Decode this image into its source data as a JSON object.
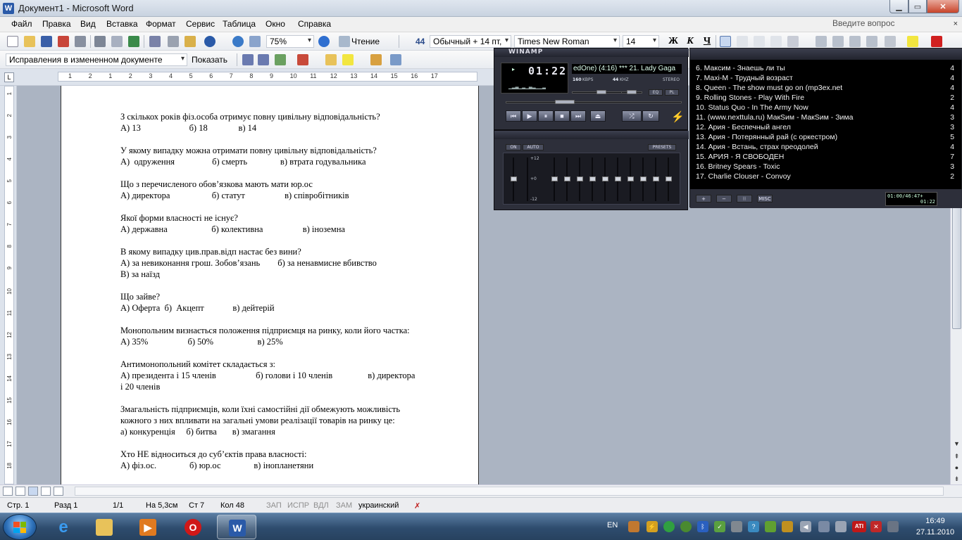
{
  "window": {
    "title": "Документ1 - Microsoft Word",
    "app_icon_letter": "W"
  },
  "menu": {
    "items": [
      "Файл",
      "Правка",
      "Вид",
      "Вставка",
      "Формат",
      "Сервис",
      "Таблица",
      "Окно",
      "Справка"
    ],
    "ask_placeholder": "Введите вопрос",
    "close_glyph": "×"
  },
  "toolbar": {
    "zoom": "75%",
    "read_label": "Чтение",
    "style": "Обычный + 14 пт,",
    "font": "Times New Roman",
    "size": "14",
    "bold": "Ж",
    "italic": "К",
    "underline": "Ч",
    "style_icon": "44",
    "track_changes_mode": "Исправления в измененном документе",
    "show_label": "Показать"
  },
  "ruler": {
    "marks": [
      "1",
      "2",
      "1",
      "2",
      "3",
      "4",
      "5",
      "6",
      "7",
      "8",
      "9",
      "10",
      "11",
      "12",
      "13",
      "14",
      "15",
      "16",
      "17"
    ],
    "vmarks": [
      "1",
      "2",
      "3",
      "4",
      "5",
      "6",
      "7",
      "8",
      "9",
      "10",
      "11",
      "12",
      "13",
      "14",
      "15",
      "16",
      "17",
      "18"
    ]
  },
  "document": {
    "questions": [
      {
        "q": "З скількох років фіз.особа отримує повну цивільну відповідальність?",
        "a": [
          "А) 13                      б) 18              в) 14"
        ]
      },
      {
        "q": "У якому випадку можна отримати повну цивільну відповідальність?",
        "a": [
          "А)  одруження                 б) смерть               в) втрата годувальника"
        ]
      },
      {
        "q": "Що з перечисленого обов’язкова мають мати юр.ос",
        "a": [
          "А) директора                   б) статут                  в) співробітників"
        ]
      },
      {
        "q": "Якої форми власності не існує?",
        "a": [
          "А) державна                    б) колективна                  в) іноземна"
        ]
      },
      {
        "q": "В якому випадку цив.прав.відп настає без вини?",
        "a": [
          "А) за невиконання грош. Зобов’язань        б) за ненавмисне вбивство",
          "В) за наїзд"
        ]
      },
      {
        "q": "Що зайве?",
        "a": [
          "А) Оферта  б)  Акцепт             в) дейтерій"
        ]
      },
      {
        "q": "Монопольним визнається положення підприємця на ринку, коли його частка:",
        "a": [
          "А) 35%                  б) 50%                    в) 25%"
        ]
      },
      {
        "q": "Антимонопольний комітет складається з:",
        "a": [
          "А) президента і 15 членів                  б) голови і 10 членів                в) директора",
          "і 20 членів"
        ]
      },
      {
        "q": "Змагальність підприємців, коли їхні самостійні дії обмежують можливість",
        "a": [
          "кожного з них впливати на загальні умови реалізації товарів на ринку це:",
          "а) конкуренція     б) битва       в) змагання"
        ]
      },
      {
        "q": "Хто НЕ відноситься до суб’єктів права власності:",
        "a": [
          "А) фіз.ос.               б) юр.ос               в) інопланетяни"
        ]
      }
    ]
  },
  "statusbar": {
    "page": "Стр.  1",
    "section": "Разд  1",
    "pages": "1/1",
    "at": "На 5,3см",
    "line": "Ст  7",
    "col": "Кол  48",
    "rec": "ЗАП",
    "trk": "ИСПР",
    "ext": "ВДЛ",
    "ovr": "ЗАМ",
    "language": "украинский"
  },
  "winamp": {
    "title": "WINAMP",
    "time": "01:22",
    "ticker": "edOne) (4:16)  ***  21. Lady Gaga",
    "kbps": "160",
    "kbps_label": "KBPS",
    "khz": "44",
    "khz_label": "KHZ",
    "stereo": "STEREO",
    "eq_btn": "EQ",
    "pl_btn": "PL",
    "eq_on": "ON",
    "eq_auto": "AUTO",
    "eq_presets": "PRESETS",
    "eq_plus": "+12",
    "eq_zero": "+0",
    "eq_minus": "-12"
  },
  "playlist": {
    "items": [
      {
        "t": "6. Максим - Знаешь ли ты",
        "len": "4:"
      },
      {
        "t": "7. Maxi-M - Трудный возраст",
        "len": "4:"
      },
      {
        "t": "8. Queen - The show must go on (mp3ex.net",
        "len": "4:"
      },
      {
        "t": "9. Rolling Stones - Play With Fire",
        "len": "2:"
      },
      {
        "t": "10. Status Quo - In The Army Now",
        "len": "4:"
      },
      {
        "t": "11. (www.nexttula.ru) МакSим - МакSим - Зима",
        "len": "3:"
      },
      {
        "t": "12. Ария - Беспечный ангел",
        "len": "3:"
      },
      {
        "t": "13. Ария - Потерянный рай (с оркестром)",
        "len": "5:"
      },
      {
        "t": "14. Ария - Встань, страх преодолей",
        "len": "4:"
      },
      {
        "t": "15. АРИЯ - Я СВОБОДЕН",
        "len": "7:"
      },
      {
        "t": "16. Britney Spears - Toxic",
        "len": "3:"
      },
      {
        "t": "17. Charlie Clouser - Convoy",
        "len": "2:"
      }
    ],
    "add": "+",
    "remove": "−",
    "select": "⁝⁝",
    "misc": "MISC",
    "mini_time": "01:00/46:47+",
    "mini_clock": "01:22"
  },
  "taskbar": {
    "lang": "EN",
    "time": "16:49",
    "date": "27.11.2010",
    "word_letter": "W"
  }
}
